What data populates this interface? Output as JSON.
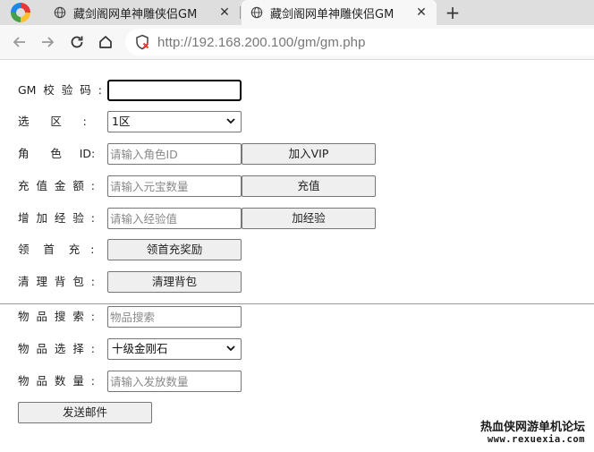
{
  "browser": {
    "tabs": [
      {
        "title": "藏剑阁网单神雕侠侣GM",
        "active": false,
        "icon": "globe-icon"
      },
      {
        "title": "藏剑阁网单神雕侠侣GM",
        "active": true,
        "icon": "globe-icon"
      }
    ],
    "url": "http://192.168.200.100/gm/gm.php"
  },
  "form": {
    "gm_code": {
      "label": "GM  校  验  码  :",
      "value": ""
    },
    "zone": {
      "label": "选      区      :",
      "selected": "1区"
    },
    "role": {
      "label": "角      色     ID:",
      "placeholder": "请输入角色ID",
      "button": "加入VIP"
    },
    "recharge": {
      "label": "充  值  金  额  :",
      "placeholder": "请输入元宝数量",
      "button": "充值"
    },
    "exp": {
      "label": "增  加  经  验  :",
      "placeholder": "请输入经验值",
      "button": "加经验"
    },
    "first_recharge": {
      "label": "领    首    充   :",
      "button": "领首充奖励"
    },
    "clear_bag": {
      "label": "清  理  背  包  :",
      "button": "清理背包"
    },
    "item_search": {
      "label": "物  品  搜  索  :",
      "placeholder": "物品搜索"
    },
    "item_select": {
      "label": "物  品  选  择  :",
      "selected": "十级金刚石"
    },
    "item_qty": {
      "label": "物  品  数  量  :",
      "placeholder": "请输入发放数量"
    },
    "send_mail": {
      "button": "发送邮件"
    }
  },
  "watermark": {
    "line1": "热血侠网游单机论坛",
    "line2": "www.rexuexia.com"
  }
}
